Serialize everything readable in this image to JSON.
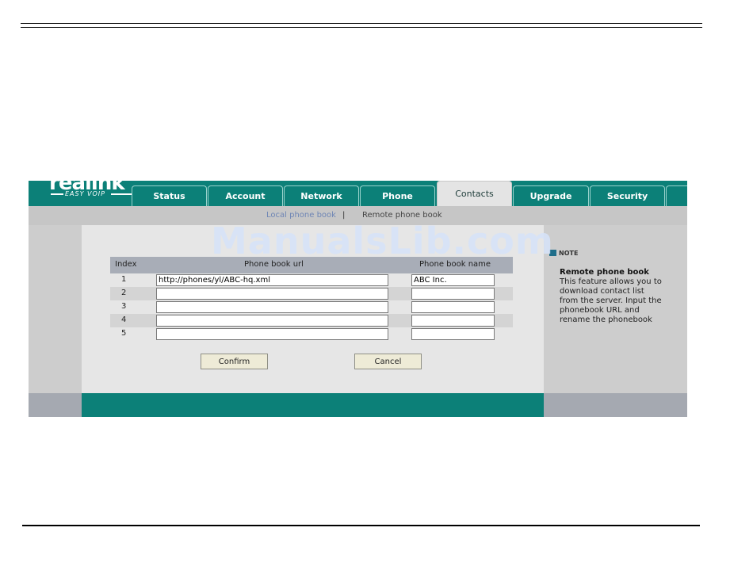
{
  "brand": {
    "logo_text": "realink",
    "tagline": "EASY VOIP"
  },
  "tabs": [
    {
      "label": "Status"
    },
    {
      "label": "Account"
    },
    {
      "label": "Network"
    },
    {
      "label": "Phone"
    },
    {
      "label": "Contacts",
      "active": true
    },
    {
      "label": "Upgrade"
    },
    {
      "label": "Security"
    }
  ],
  "subnav": {
    "local_label": "Local phone book",
    "separator": "|",
    "remote_label": "Remote phone book"
  },
  "watermark": "ManualsLib.com",
  "table": {
    "headers": {
      "index": "Index",
      "url": "Phone book url",
      "name": "Phone book name"
    },
    "rows": [
      {
        "index": "1",
        "url": "http://phones/yl/ABC-hq.xml",
        "name": "ABC Inc."
      },
      {
        "index": "2",
        "url": "",
        "name": ""
      },
      {
        "index": "3",
        "url": "",
        "name": ""
      },
      {
        "index": "4",
        "url": "",
        "name": ""
      },
      {
        "index": "5",
        "url": "",
        "name": ""
      }
    ]
  },
  "buttons": {
    "confirm": "Confirm",
    "cancel": "Cancel"
  },
  "note": {
    "heading": "NOTE",
    "title": "Remote phone book",
    "body": "This feature allows you to download contact list from the server. Input the phonebook URL and rename the phonebook"
  },
  "colors": {
    "accent": "#0c8078",
    "background_gray": "#cdcdcd",
    "panel": "#e6e6e6"
  }
}
